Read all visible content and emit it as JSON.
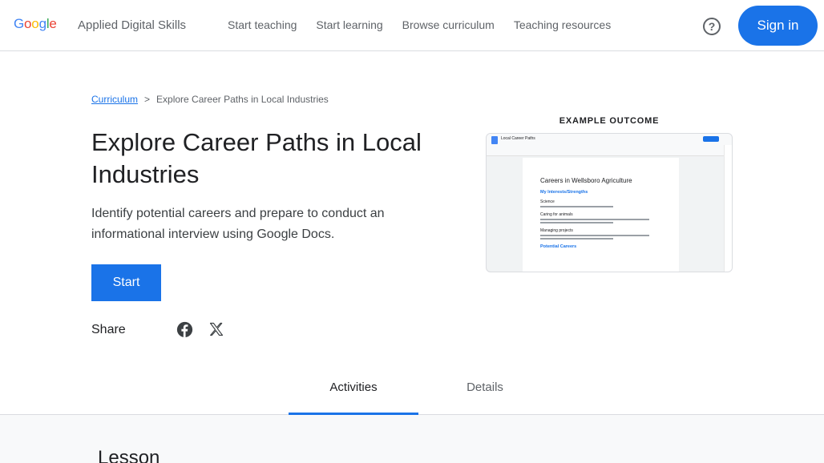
{
  "header": {
    "logo": [
      "G",
      "o",
      "o",
      "g",
      "l",
      "e"
    ],
    "logo_colors": [
      "#4285f4",
      "#ea4335",
      "#fbbc05",
      "#4285f4",
      "#34a853",
      "#ea4335"
    ],
    "product": "Applied Digital Skills",
    "nav": [
      "Start teaching",
      "Start learning",
      "Browse curriculum",
      "Teaching resources"
    ],
    "help_icon": "?",
    "sign_in": "Sign in"
  },
  "breadcrumb": {
    "root": "Curriculum",
    "separator": ">",
    "current": "Explore Career Paths in Local Industries"
  },
  "lesson": {
    "title": "Explore Career Paths in Local Industries",
    "description": "Identify potential careers and prepare to conduct an informational interview using Google Docs.",
    "start_label": "Start",
    "share_label": "Share"
  },
  "example": {
    "label": "EXAMPLE OUTCOME",
    "doc_title": "Local Career Paths",
    "doc_heading": "Careers in Wellsboro Agriculture",
    "section_interests": "My Interests/Strengths",
    "item_science": "Science",
    "item_animals": "Caring for animals",
    "item_projects": "Managing projects",
    "section_careers": "Potential Careers"
  },
  "tabs": {
    "activities": "Activities",
    "details": "Details"
  },
  "lower": {
    "heading": "Lesson"
  },
  "colors": {
    "accent": "#1a73e8"
  }
}
